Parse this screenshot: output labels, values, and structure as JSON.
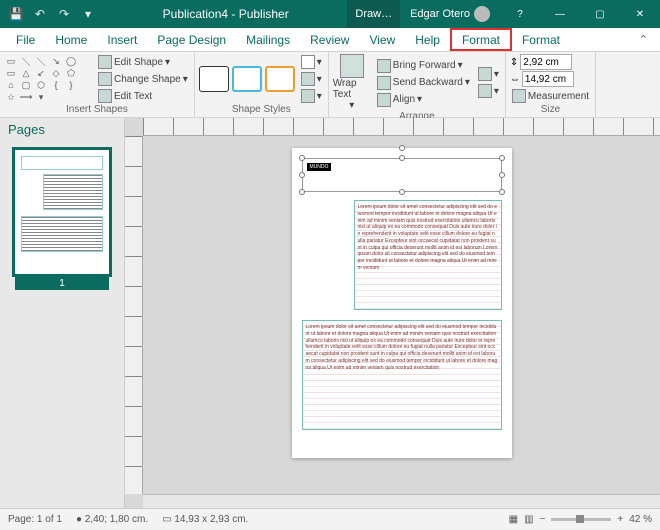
{
  "titlebar": {
    "doc": "Publication4 - Publisher",
    "context": "Draw…",
    "user": "Edgar Otero"
  },
  "tabs": {
    "items": [
      "File",
      "Home",
      "Insert",
      "Page Design",
      "Mailings",
      "Review",
      "View",
      "Help",
      "Format",
      "Format"
    ]
  },
  "ribbon": {
    "groups": {
      "insertShapes": "Insert Shapes",
      "shapeStyles": "Shape Styles",
      "arrange": "Arrange",
      "size": "Size"
    },
    "editShape": "Edit Shape",
    "changeShape": "Change Shape",
    "editText": "Edit Text",
    "wrapText": "Wrap Text",
    "bringForward": "Bring Forward",
    "sendBackward": "Send Backward",
    "align": "Align",
    "width": "2,92 cm",
    "height": "14,92 cm",
    "measurement": "Measurement"
  },
  "pagesPane": {
    "title": "Pages",
    "pagenum": "1"
  },
  "page": {
    "tag": "MUNDO"
  },
  "status": {
    "page": "Page: 1 of 1",
    "pos": "2,40; 1,80 cm.",
    "size": "14,93 x  2,93 cm.",
    "zoom": "42 %"
  }
}
